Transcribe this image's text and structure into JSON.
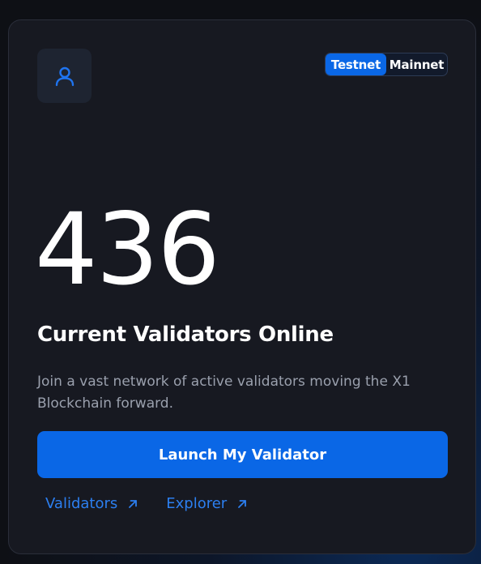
{
  "colors": {
    "accent": "#0a67e6",
    "link": "#2c7ff0",
    "card_bg": "#171921",
    "muted_text": "#9aa0ad"
  },
  "header": {
    "avatar_icon": "user-icon",
    "network_toggle": {
      "options": [
        "Testnet",
        "Mainnet"
      ],
      "selected": "Testnet"
    }
  },
  "stats": {
    "validator_count": "436",
    "headline": "Current Validators Online",
    "description": "Join a vast network of active validators moving the X1 Blockchain forward."
  },
  "actions": {
    "launch_label": "Launch My Validator"
  },
  "links": [
    {
      "label": "Validators",
      "icon": "arrow-up-right-icon"
    },
    {
      "label": "Explorer",
      "icon": "arrow-up-right-icon"
    }
  ]
}
